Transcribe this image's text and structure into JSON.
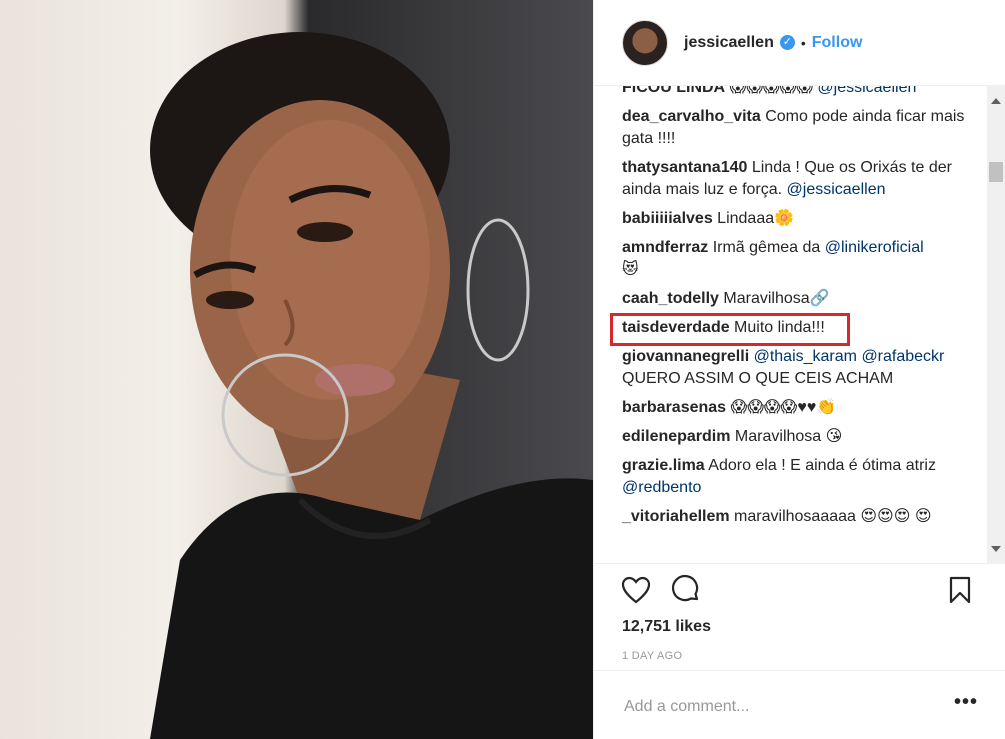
{
  "post": {
    "username": "jessicaellen",
    "verified_icon": "verified-badge-icon",
    "separator": "•",
    "follow_label": "Follow",
    "likes": "12,751 likes",
    "time": "1 DAY AGO",
    "add_comment_placeholder": "Add a comment...",
    "more_label": "•••"
  },
  "comments": [
    {
      "user": "FICOU LINDA",
      "text": " 😱😱😱😱😱 ",
      "mention": "@jessicaellen"
    },
    {
      "user": "dea_carvalho_vita",
      "text": " Como pode ainda ficar mais gata !!!!"
    },
    {
      "user": "thatysantana140",
      "text": " Linda ! Que os Orixás te der ainda mais luz e força. ",
      "mention": "@jessicaellen"
    },
    {
      "user": "babiiiiialves",
      "text": " Lindaaa🌼"
    },
    {
      "user": "amndferraz",
      "text": " Irmã gêmea da ",
      "mention": "@linikeroficial",
      "tail": " 😻"
    },
    {
      "user": "caah_todelly",
      "text": " Maravilhosa🔗"
    },
    {
      "user": "taisdeverdade",
      "text": " Muito linda!!!"
    },
    {
      "user": "giovannanegrelli",
      "text": " ",
      "mention": "@thais_karam",
      "mention2": "@rafabeckr",
      "tail": " QUERO ASSIM O QUE CEIS ACHAM"
    },
    {
      "user": "barbarasenas",
      "text": " 😱😱😱😱♥♥👏"
    },
    {
      "user": "edilenepardim",
      "text": " Maravilhosa 😘"
    },
    {
      "user": "grazie.lima",
      "text": " Adoro ela ! E ainda é ótima atriz ",
      "mention": "@redbento"
    },
    {
      "user": "_vitoriahellem",
      "text": " maravilhosaaaaa 😍😍😍 😍"
    }
  ],
  "colors": {
    "accent": "#3897f0",
    "highlight": "#d7282f",
    "mention": "#003569"
  }
}
